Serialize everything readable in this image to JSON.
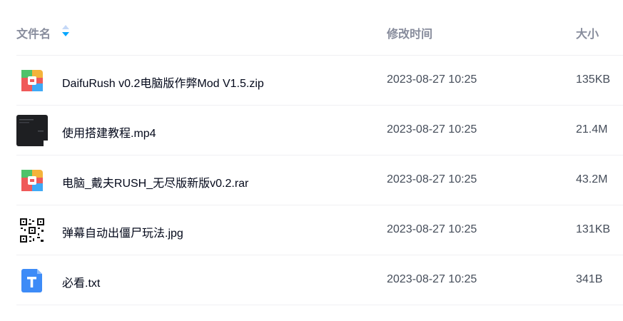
{
  "header": {
    "name_label": "文件名",
    "time_label": "修改时间",
    "size_label": "大小",
    "sort_icon": "sort-icon"
  },
  "files": [
    {
      "name": "DaifuRush v0.2电脑版作弊Mod V1.5.zip",
      "time": "2023-08-27 10:25",
      "size": "135KB",
      "icon": "archive-icon"
    },
    {
      "name": "使用搭建教程.mp4",
      "time": "2023-08-27 10:25",
      "size": "21.4M",
      "icon": "video-thumbnail"
    },
    {
      "name": "电脑_戴夫RUSH_无尽版新版v0.2.rar",
      "time": "2023-08-27 10:25",
      "size": "43.2M",
      "icon": "archive-icon"
    },
    {
      "name": "弹幕自动出僵尸玩法.jpg",
      "time": "2023-08-27 10:25",
      "size": "131KB",
      "icon": "qr-code-thumbnail"
    },
    {
      "name": "必看.txt",
      "time": "2023-08-27 10:25",
      "size": "341B",
      "icon": "text-file-icon"
    }
  ],
  "colors": {
    "header_text": "#878c9c",
    "name_text": "#03081a",
    "meta_text": "#454d5a",
    "divider": "#f0f0f3",
    "sort_active": "#06a7ff",
    "sort_inactive": "#c4d8f7",
    "txt_icon": "#3d8bf7"
  }
}
